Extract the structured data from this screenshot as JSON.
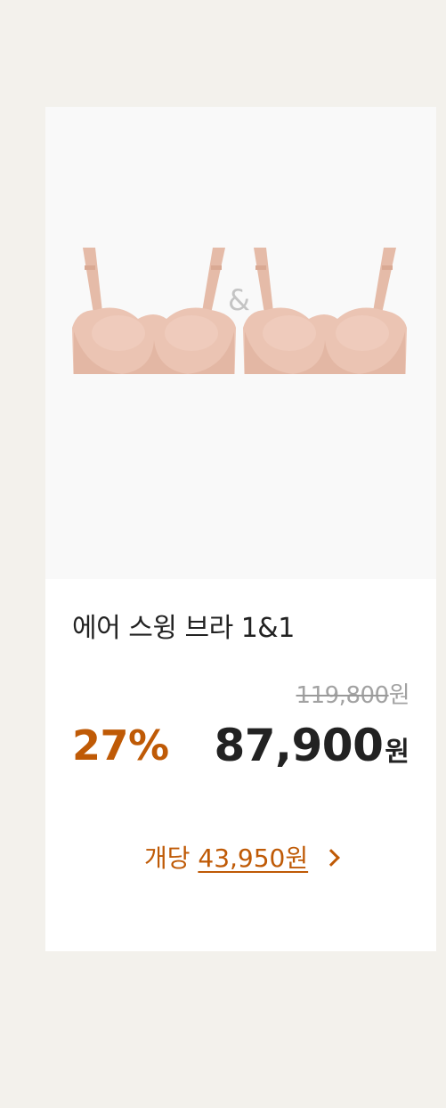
{
  "product": {
    "image_separator": "&",
    "title": "에어 스윙 브라 1&1",
    "original_price": "119,800",
    "original_currency": "원",
    "discount": "27%",
    "sale_price": "87,900",
    "sale_currency": "원",
    "per_unit_label": "개당",
    "per_unit_price": "43,950원"
  },
  "colors": {
    "accent": "#bf5a06",
    "background": "#f3f1ec",
    "card": "#ffffff",
    "product_tone": "#e9c3b2"
  }
}
